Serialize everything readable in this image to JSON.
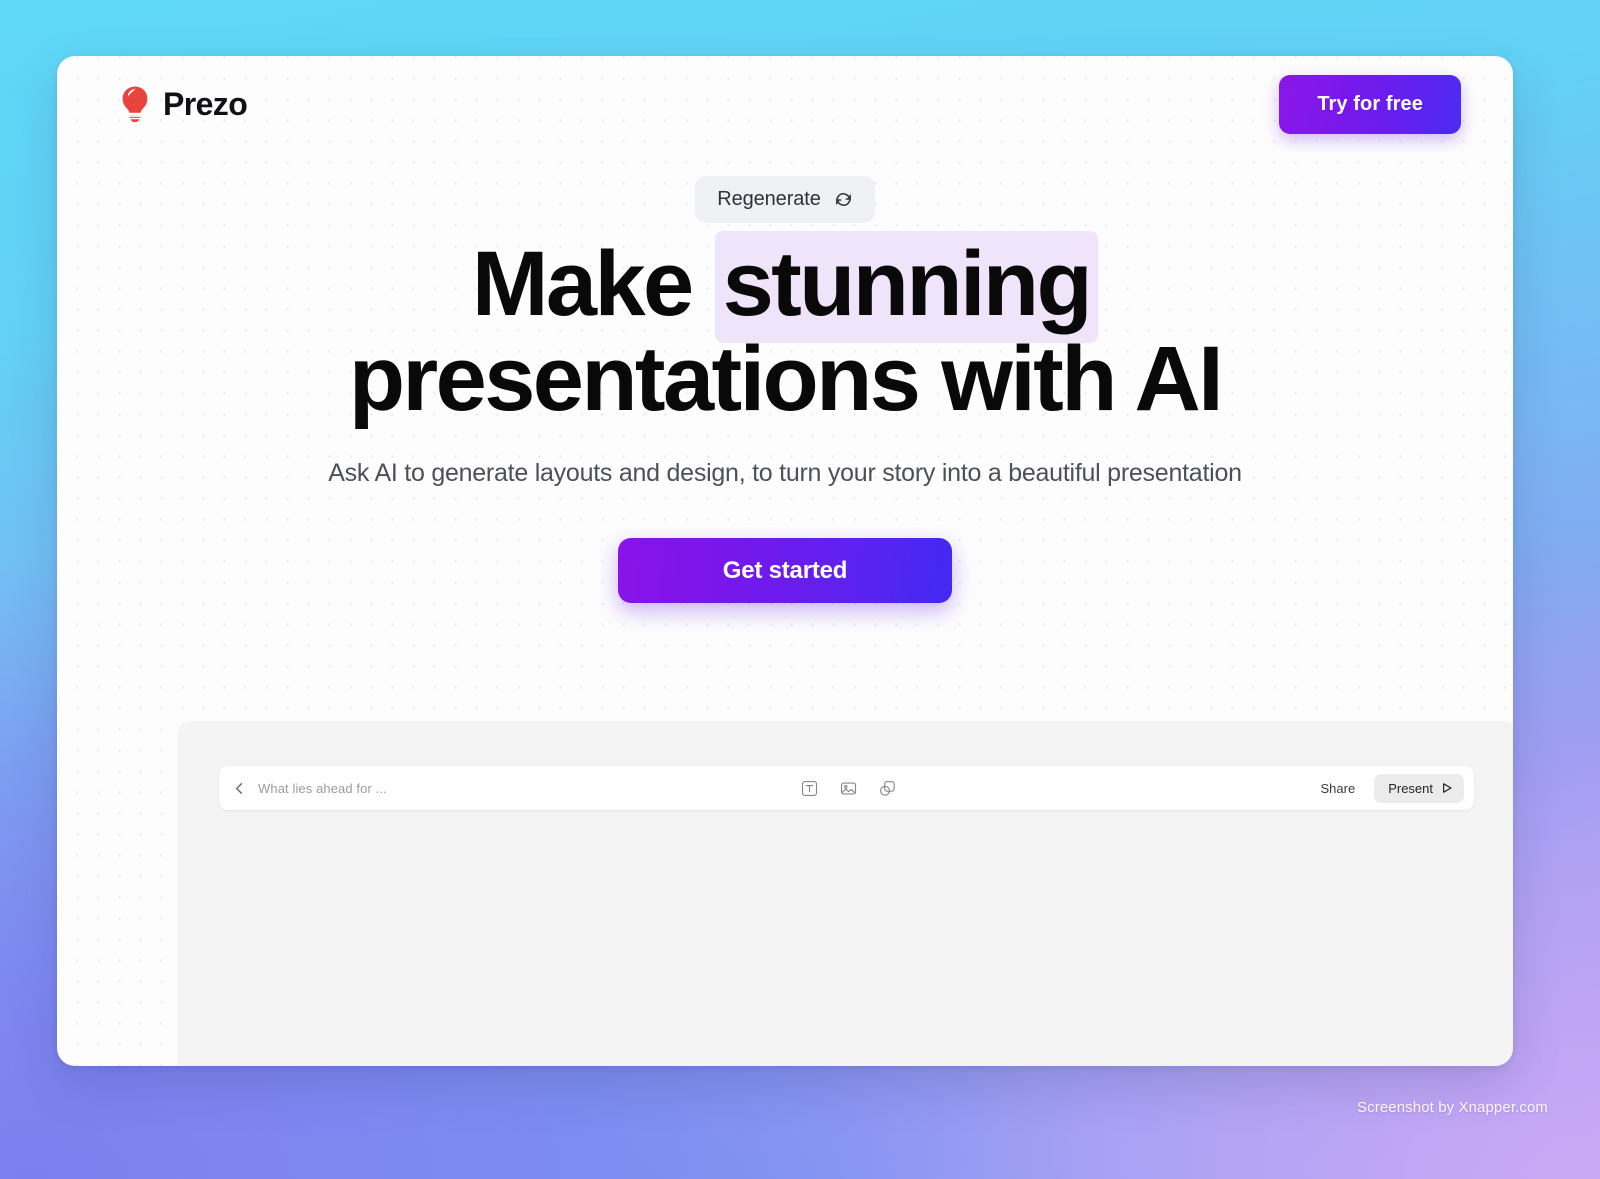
{
  "header": {
    "brand_name": "Prezo",
    "brand_icon": "lightbulb-icon",
    "brand_color": "#e8443f",
    "cta_label": "Try for free",
    "cta_gradient_from": "#8b17e8",
    "cta_gradient_to": "#4b2bf2"
  },
  "hero": {
    "regenerate_label": "Regenerate",
    "regenerate_icon": "refresh-cycle-icon",
    "headline_part1": "Make ",
    "headline_highlight": "stunning",
    "headline_part2": " presentations with AI",
    "highlight_color": "#f0e4fb",
    "subheadline": "Ask AI to generate layouts and design, to turn your story into a beautiful presentation",
    "get_started_label": "Get started",
    "get_started_gradient_from": "#8a13e9",
    "get_started_gradient_to": "#4329f3"
  },
  "editor": {
    "back_icon": "chevron-left-icon",
    "document_title": "What lies ahead for ...",
    "tools": [
      {
        "name": "text-tool-icon",
        "title": "Text"
      },
      {
        "name": "image-tool-icon",
        "title": "Image"
      },
      {
        "name": "shapes-tool-icon",
        "title": "Shapes"
      }
    ],
    "share_label": "Share",
    "present_label": "Present",
    "present_icon": "play-triangle-icon"
  },
  "watermark": {
    "text": "Screenshot by Xnapper.com"
  }
}
